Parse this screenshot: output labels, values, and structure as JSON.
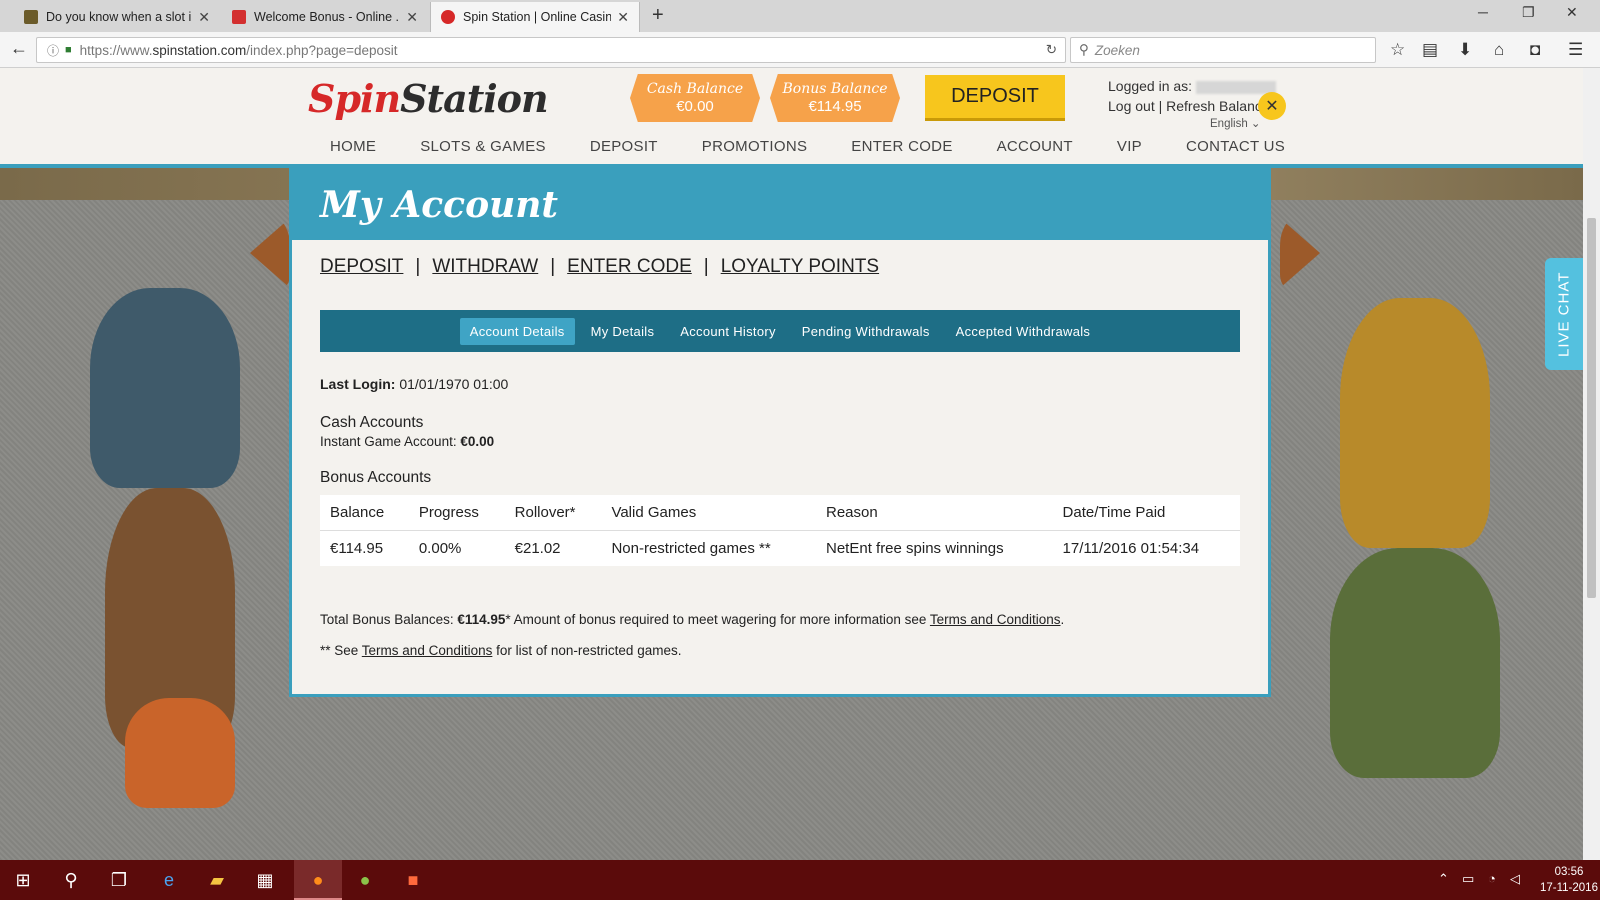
{
  "browser": {
    "tabs": [
      {
        "title": "Do you know when a slot i...",
        "favicon_color": "#6b5b2a"
      },
      {
        "title": "Welcome Bonus - Online ...",
        "favicon_color": "#d32f2f"
      },
      {
        "title": "Spin Station | Online Casin...",
        "favicon_color": "#d62828",
        "active": true
      }
    ],
    "url_prefix": "https://www.",
    "url_domain": "spinstation.com",
    "url_path": "/index.php?page=deposit",
    "search_placeholder": "Zoeken"
  },
  "site": {
    "logo_part1": "Spin",
    "logo_part2": "Station",
    "cash_balance_label": "Cash Balance",
    "cash_balance_value": "€0.00",
    "bonus_balance_label": "Bonus Balance",
    "bonus_balance_value": "€114.95",
    "deposit_button": "DEPOSIT",
    "logged_in_label": "Logged in as:",
    "logout_link": "Log out",
    "refresh_link": "Refresh Balance",
    "language": "English",
    "nav": [
      "HOME",
      "SLOTS & GAMES",
      "DEPOSIT",
      "PROMOTIONS",
      "ENTER CODE",
      "ACCOUNT",
      "VIP",
      "CONTACT US"
    ],
    "live_chat": "LIVE CHAT"
  },
  "modal": {
    "title": "My Account",
    "links": [
      "DEPOSIT",
      "WITHDRAW",
      "ENTER CODE",
      "LOYALTY POINTS"
    ],
    "subtabs": [
      "Account Details",
      "My Details",
      "Account History",
      "Pending Withdrawals",
      "Accepted Withdrawals"
    ],
    "last_login_label": "Last Login:",
    "last_login_value": "01/01/1970 01:00",
    "cash_accounts_heading": "Cash Accounts",
    "instant_account_label": "Instant Game Account:",
    "instant_account_value": "€0.00",
    "bonus_accounts_heading": "Bonus Accounts",
    "table": {
      "headers": [
        "Balance",
        "Progress",
        "Rollover*",
        "Valid Games",
        "Reason",
        "Date/Time Paid"
      ],
      "rows": [
        [
          "€114.95",
          "0.00%",
          "€21.02",
          "Non-restricted games **",
          "NetEnt free spins winnings",
          "17/11/2016 01:54:34"
        ]
      ]
    },
    "total_label": "Total Bonus Balances:",
    "total_value": "€114.95",
    "total_note": "* Amount of bonus required to meet wagering for more information see",
    "terms_link": "Terms and Conditions",
    "footnote_prefix": "** See",
    "footnote_suffix": "for list of non-restricted games."
  },
  "taskbar": {
    "time": "03:56",
    "date": "17-11-2016"
  }
}
